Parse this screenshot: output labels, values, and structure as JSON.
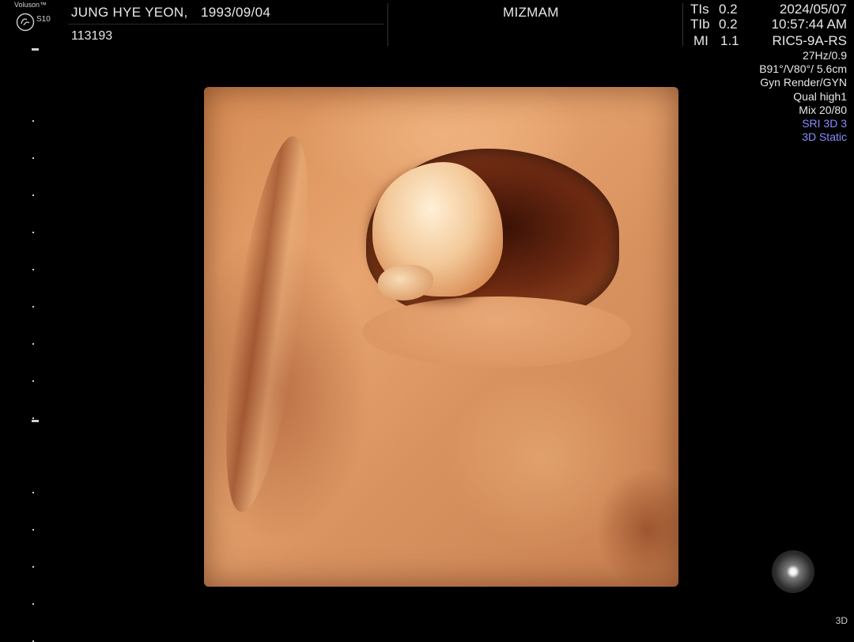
{
  "brand": {
    "name": "Voluson™",
    "model": "S10",
    "logo_icon": "ge-logo-icon"
  },
  "patient": {
    "name": "JUNG HYE YEON,",
    "dob": "1993/09/04",
    "id": "113193"
  },
  "hospital": "MIZMAM",
  "indices": {
    "tis_label": "TIs",
    "tis_value": "0.2",
    "tib_label": "TIb",
    "tib_value": "0.2",
    "mi_label": "MI",
    "mi_value": "1.1"
  },
  "exam": {
    "date": "2024/05/07",
    "time": "10:57:44 AM",
    "probe": "RIC5-9A-RS"
  },
  "params": {
    "hz": "27Hz/0.9",
    "angle": "B91°/V80°/ 5.6cm",
    "render": "Gyn Render/GYN",
    "quality": "Qual high1",
    "mix": "Mix 20/80",
    "sri": "SRI 3D 3",
    "static": "3D Static"
  },
  "mode": "3D",
  "colors": {
    "background": "#000000",
    "text": "#e8e8e8",
    "accent_blue": "#8a8cff",
    "render_skin": "#e0a06a"
  },
  "icons": {
    "orientation": "orientation-ball-icon"
  }
}
